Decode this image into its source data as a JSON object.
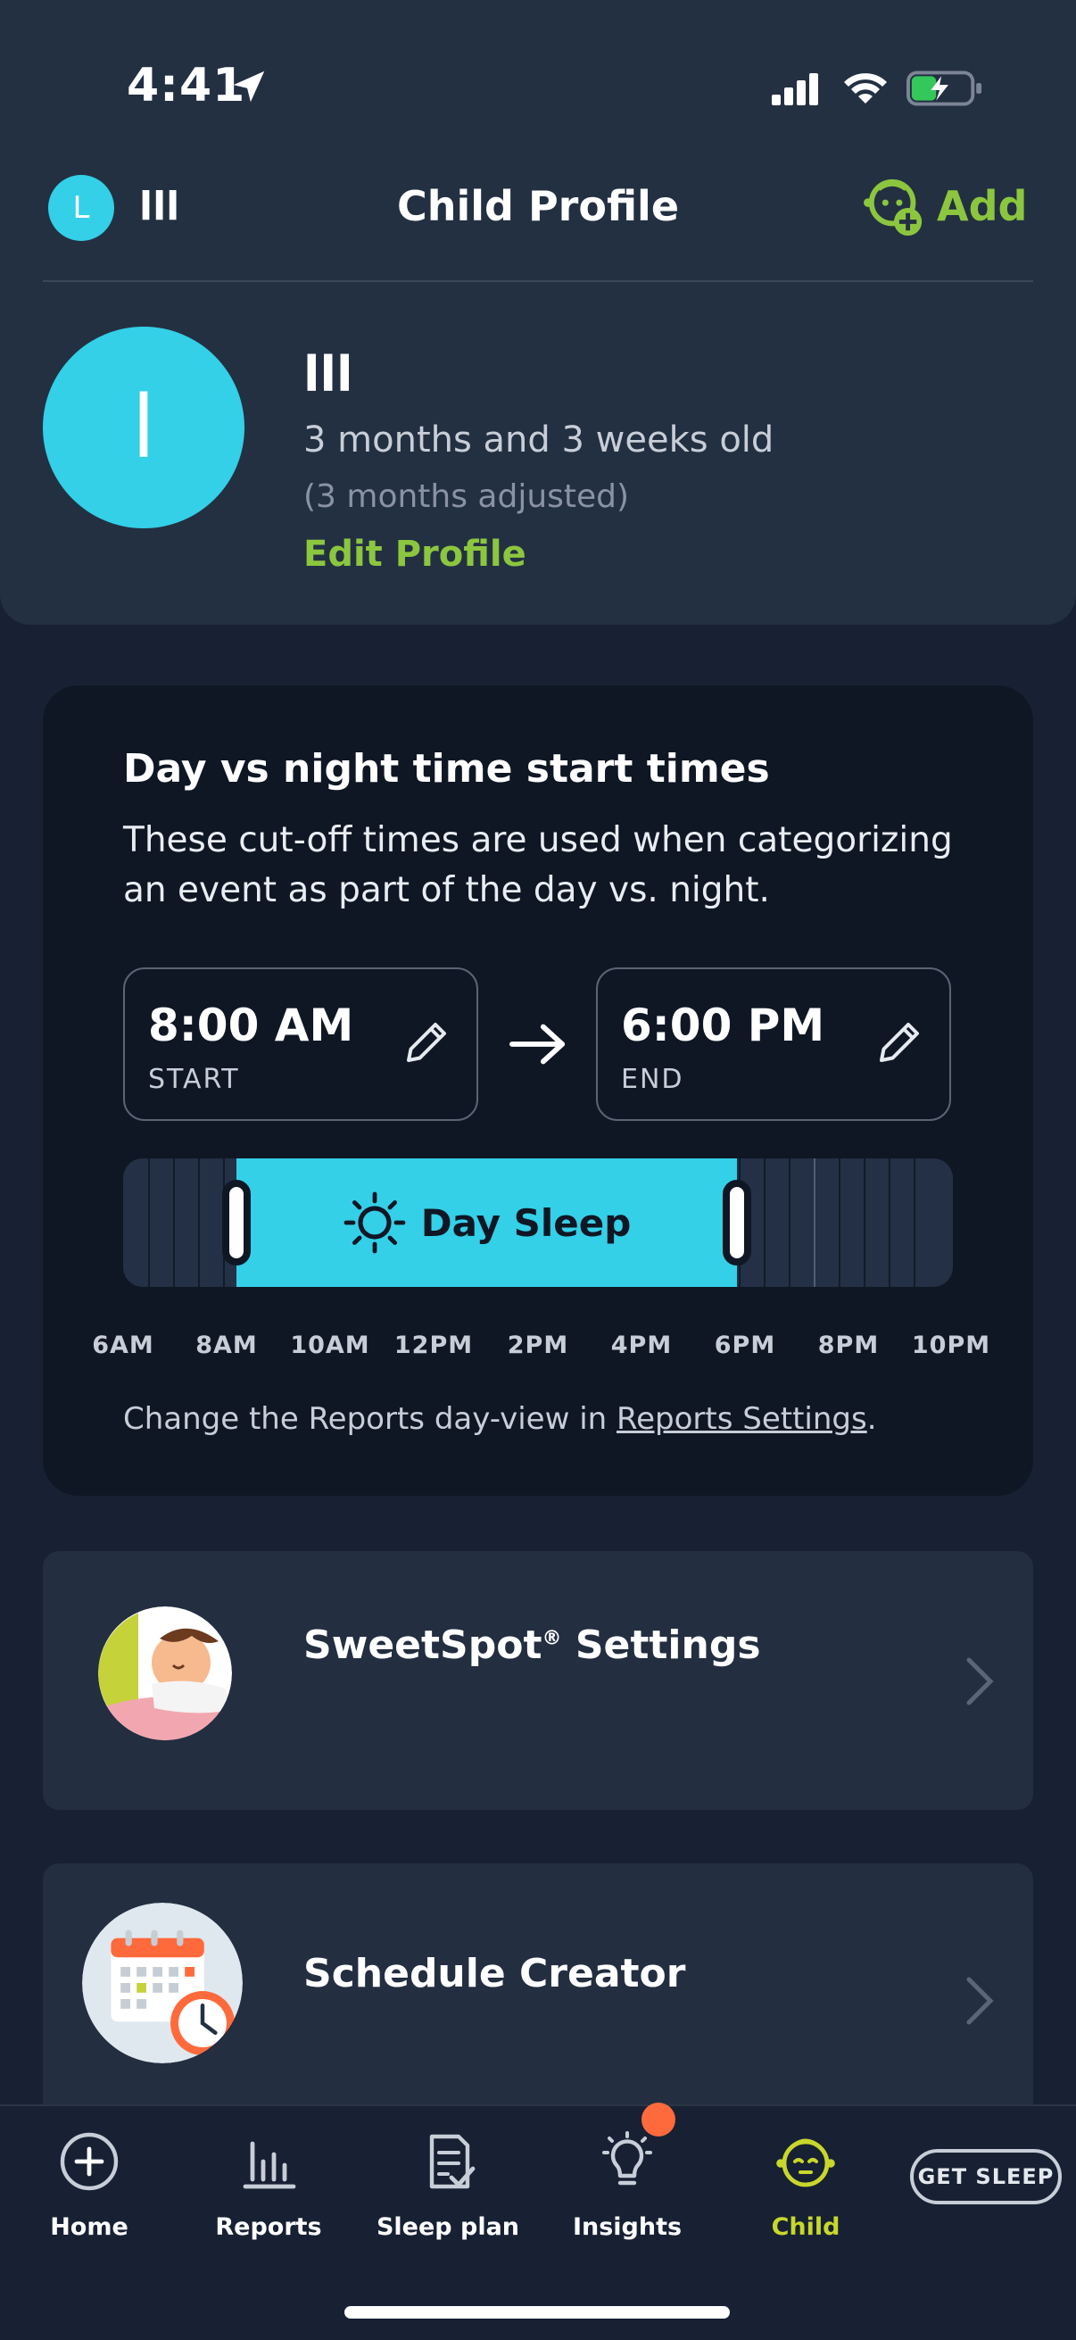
{
  "status_bar": {
    "time": "4:41"
  },
  "header": {
    "user_initial": "L",
    "user_name": "lll",
    "title": "Child Profile",
    "add_label": "Add"
  },
  "profile": {
    "avatar_initial": "l",
    "name": "lll",
    "age": "3 months and 3 weeks old",
    "adjusted": "(3 months adjusted)",
    "edit_label": "Edit Profile"
  },
  "day_night": {
    "title": "Day vs night time start times",
    "description": "These cut-off times are used when categorizing an event as part of the day vs. night.",
    "start_time": "8:00 AM",
    "start_label": "START",
    "end_time": "6:00 PM",
    "end_label": "END",
    "bar_label": "Day Sleep",
    "timeline_labels": [
      "6AM",
      "8AM",
      "10AM",
      "12PM",
      "2PM",
      "4PM",
      "6PM",
      "8PM",
      "10PM"
    ],
    "note_prefix": "Change the Reports day-view in ",
    "note_link": "Reports Settings",
    "note_suffix": "."
  },
  "cards": {
    "sweetspot_title": "SweetSpot",
    "sweetspot_reg": "®",
    "sweetspot_suffix": " Settings",
    "schedule_title": "Schedule Creator"
  },
  "nav": {
    "home": "Home",
    "reports": "Reports",
    "sleep_plan": "Sleep plan",
    "insights": "Insights",
    "child": "Child",
    "get_sleep": "GET SLEEP"
  },
  "colors": {
    "accent_green": "#8cc63f",
    "accent_cyan": "#33d0e8",
    "active_nav": "#c9d72c",
    "badge": "#ff6a3d"
  }
}
